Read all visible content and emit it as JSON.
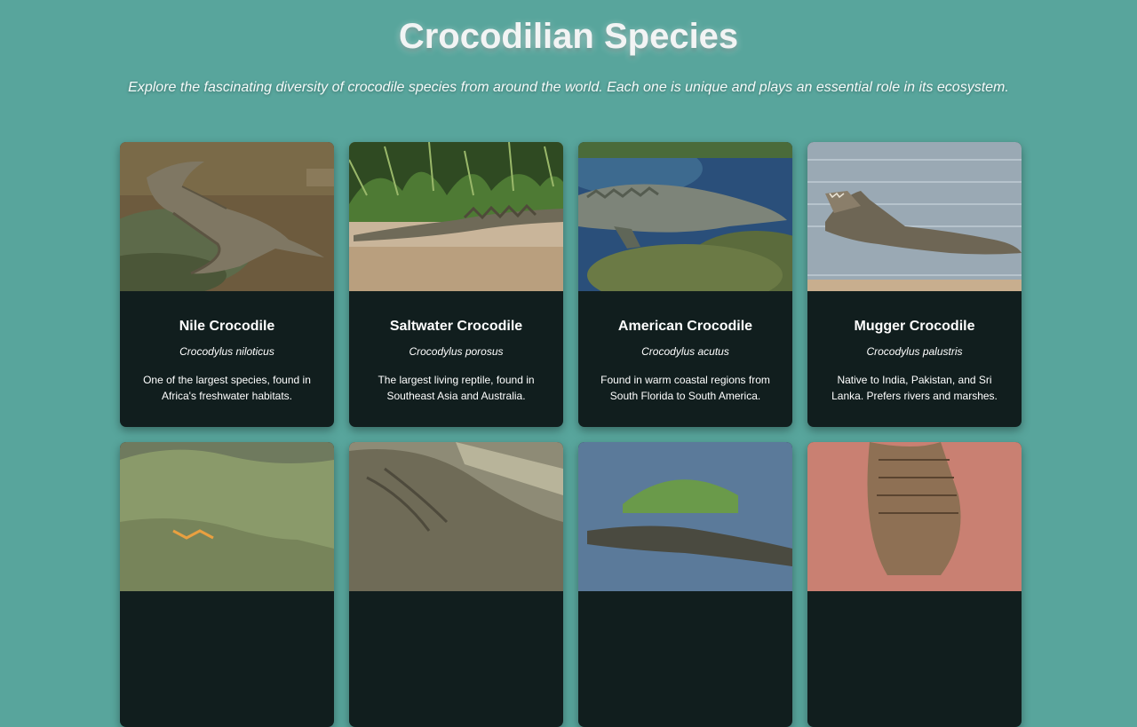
{
  "header": {
    "title": "Crocodilian Species",
    "subtitle": "Explore the fascinating diversity of crocodile species from around the world. Each one is unique and plays an essential role in its ecosystem."
  },
  "cards": [
    {
      "name": "Nile Crocodile",
      "latin": "Crocodylus niloticus",
      "description": "One of the largest species, found in Africa's freshwater habitats.",
      "photo_icon": "nile-crocodile-photo"
    },
    {
      "name": "Saltwater Crocodile",
      "latin": "Crocodylus porosus",
      "description": "The largest living reptile, found in Southeast Asia and Australia.",
      "photo_icon": "saltwater-crocodile-photo"
    },
    {
      "name": "American Crocodile",
      "latin": "Crocodylus acutus",
      "description": "Found in warm coastal regions from South Florida to South America.",
      "photo_icon": "american-crocodile-photo"
    },
    {
      "name": "Mugger Crocodile",
      "latin": "Crocodylus palustris",
      "description": "Native to India, Pakistan, and Sri Lanka. Prefers rivers and marshes.",
      "photo_icon": "mugger-crocodile-photo"
    },
    {
      "photo_icon": "crocodile-photo"
    },
    {
      "photo_icon": "crocodile-photo"
    },
    {
      "photo_icon": "crocodile-photo"
    },
    {
      "photo_icon": "crocodile-photo"
    }
  ],
  "colors": {
    "background": "#58a59c",
    "card_background": "#111e1e",
    "text": "#ffffff"
  }
}
